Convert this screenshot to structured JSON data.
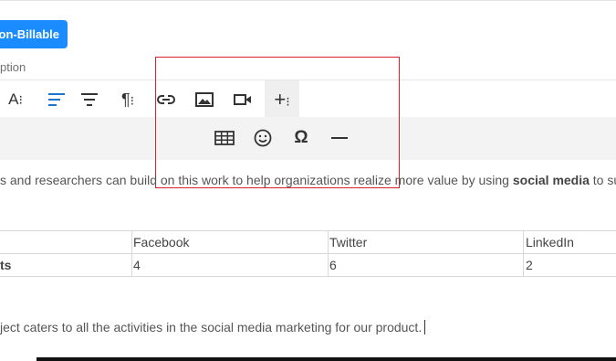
{
  "header": {
    "nonbillable_label": "on-Billable",
    "description_label": "ption"
  },
  "toolbar": {
    "items": [
      {
        "name": "font-size",
        "icon": "font-size-icon"
      },
      {
        "name": "align-left",
        "icon": "align-left-icon",
        "active": true
      },
      {
        "name": "align-center",
        "icon": "align-center-icon"
      },
      {
        "name": "paragraph-format",
        "icon": "paragraph-icon"
      },
      {
        "name": "insert-link",
        "icon": "link-icon"
      },
      {
        "name": "insert-image",
        "icon": "image-icon"
      },
      {
        "name": "insert-video",
        "icon": "video-icon"
      },
      {
        "name": "more-insert",
        "icon": "plus-more-icon",
        "expanded": true
      }
    ],
    "sub_items": [
      {
        "name": "insert-table",
        "icon": "table-icon"
      },
      {
        "name": "insert-emoticon",
        "icon": "emoticon-icon"
      },
      {
        "name": "special-characters",
        "icon": "omega-icon",
        "glyph": "Ω"
      },
      {
        "name": "insert-horizontal-line",
        "icon": "horizontal-line-icon"
      }
    ],
    "font_size_glyph": "A",
    "paragraph_glyph": "¶"
  },
  "content": {
    "para1_pre": "s and researchers can build on this work to help organizations realize more value by using ",
    "para1_bold": "social media",
    "para1_post": " to su",
    "table": {
      "headers": [
        "",
        "Facebook",
        "Twitter",
        "LinkedIn"
      ],
      "rows": [
        [
          "ts",
          "4",
          "6",
          "2"
        ]
      ]
    },
    "para2": "ject caters to all the activities in the social media marketing for our product."
  },
  "colors": {
    "accent": "#1a8cff",
    "active_icon": "#1a74d1",
    "highlight_box": "#d9232d"
  }
}
